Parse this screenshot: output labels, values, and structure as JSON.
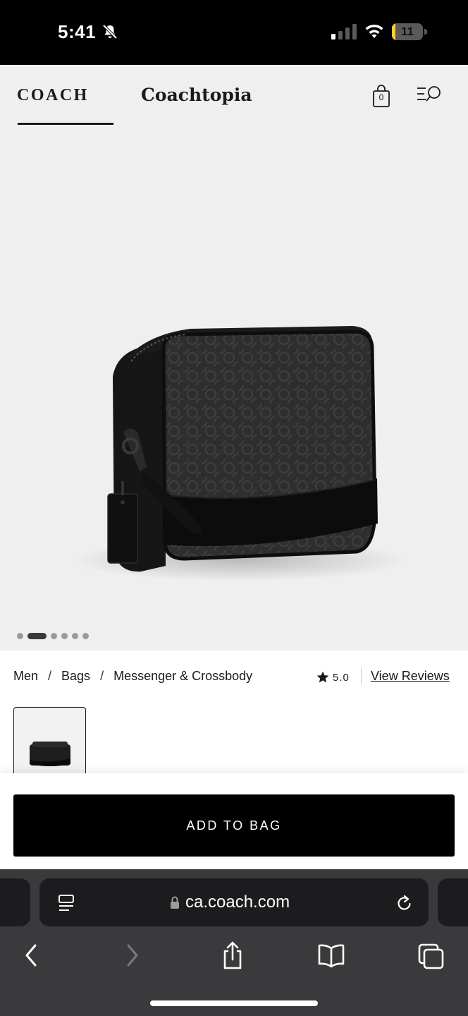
{
  "status_bar": {
    "time": "5:41",
    "battery_level": "11",
    "battery_fraction": 0.11,
    "icons": [
      "bell-muted-icon",
      "cellular-signal-icon",
      "wifi-icon",
      "battery-icon"
    ]
  },
  "header": {
    "brand_logo": "COACH",
    "coachtopia_logo": "Coachtopia",
    "bag_count": "0",
    "icons": [
      "shopping-bag-icon",
      "menu-search-icon"
    ]
  },
  "gallery": {
    "image": "black signature canvas crossbody camera bag",
    "slide_count": 6,
    "active_slide": 2
  },
  "breadcrumb": {
    "items": [
      "Men",
      "Bags",
      "Messenger & Crossbody"
    ],
    "separator": "/"
  },
  "rating": {
    "value": "5.0",
    "view_reviews_label": "View Reviews"
  },
  "cta": {
    "add_to_bag_label": "ADD TO BAG"
  },
  "browser": {
    "url": "ca.coach.com",
    "icons": [
      "reader-icon",
      "lock-icon",
      "reload-icon",
      "back-icon",
      "forward-icon",
      "share-icon",
      "bookmarks-icon",
      "tabs-icon"
    ]
  },
  "colors": {
    "page_bg": "#efefef",
    "cta_bg": "#000000",
    "browser_bar": "#3a3a3c",
    "battery_yellow": "#f2d03c"
  }
}
